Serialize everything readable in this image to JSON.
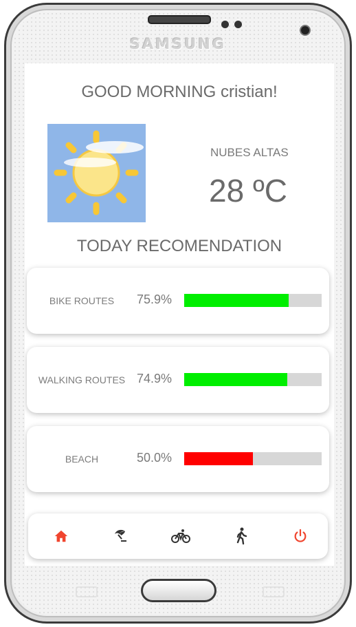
{
  "device": {
    "brand": "SAMSUNG"
  },
  "greeting": "GOOD MORNING cristian!",
  "weather": {
    "condition": "NUBES ALTAS",
    "temperature": "28 ºC",
    "icon": "sun-with-clouds-icon",
    "sky_color": "#8fb6e8"
  },
  "recommendation": {
    "title": "TODAY RECOMENDATION",
    "items": [
      {
        "label": "BIKE ROUTES",
        "percent_text": "75.9%",
        "value": 75.9,
        "color": "#00ee00"
      },
      {
        "label": "WALKING ROUTES",
        "percent_text": "74.9%",
        "value": 74.9,
        "color": "#00ee00"
      },
      {
        "label": "BEACH",
        "percent_text": "50.0%",
        "value": 50.0,
        "color": "#ff0000"
      }
    ]
  },
  "nav": {
    "items": [
      {
        "name": "home",
        "icon": "home-icon",
        "active": true
      },
      {
        "name": "beach",
        "icon": "beach-umbrella-icon",
        "active": false
      },
      {
        "name": "bike",
        "icon": "bicycle-icon",
        "active": false
      },
      {
        "name": "walk",
        "icon": "walking-person-icon",
        "active": false
      },
      {
        "name": "power",
        "icon": "power-icon",
        "active": false
      }
    ],
    "accent_color": "#f0452e",
    "icon_color": "#333333"
  }
}
